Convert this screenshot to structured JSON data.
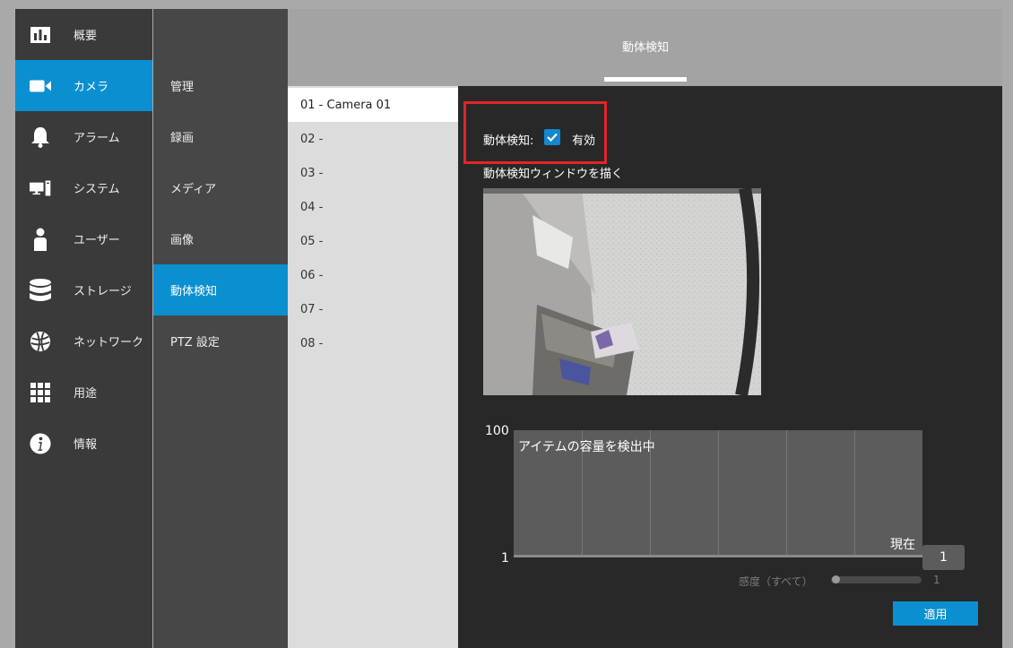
{
  "primary_nav": {
    "items": [
      {
        "label": "概要",
        "icon": "bar-chart-icon"
      },
      {
        "label": "カメラ",
        "icon": "video-camera-icon",
        "active": true
      },
      {
        "label": "アラーム",
        "icon": "bell-icon"
      },
      {
        "label": "システム",
        "icon": "computer-icon"
      },
      {
        "label": "ユーザー",
        "icon": "user-icon"
      },
      {
        "label": "ストレージ",
        "icon": "database-icon"
      },
      {
        "label": "ネットワーク",
        "icon": "globe-icon"
      },
      {
        "label": "用途",
        "icon": "grid-icon"
      },
      {
        "label": "情報",
        "icon": "info-icon"
      }
    ]
  },
  "secondary_nav": {
    "items": [
      {
        "label": "管理"
      },
      {
        "label": "録画"
      },
      {
        "label": "メディア"
      },
      {
        "label": "画像"
      },
      {
        "label": "動体検知",
        "active": true
      },
      {
        "label": "PTZ 設定"
      }
    ]
  },
  "header": {
    "tab_label": "動体検知"
  },
  "camera_list": {
    "items": [
      {
        "label": "01 - Camera 01",
        "active": true
      },
      {
        "label": "02 -"
      },
      {
        "label": "03 -"
      },
      {
        "label": "04 -"
      },
      {
        "label": "05 -"
      },
      {
        "label": "06 -"
      },
      {
        "label": "07 -"
      },
      {
        "label": "08 -"
      }
    ]
  },
  "motion": {
    "enable_label": "動体検知:",
    "enabled": true,
    "enable_text": "有効",
    "draw_window_label": "動体検知ウィンドウを描く"
  },
  "graph": {
    "y_max_label": "100",
    "y_min_label": "1",
    "title": "アイテムの容量を検出中",
    "current_label": "現在",
    "current_value": "1"
  },
  "sensitivity": {
    "label": "感度（すべて）",
    "value": "1",
    "fraction": 0.0
  },
  "apply_button_label": "適用",
  "colors": {
    "accent": "#0a90d0",
    "highlight_box": "#e0262a",
    "sidebar": "#3a3a3a",
    "subnav": "#474747",
    "content_bg": "#282828"
  }
}
